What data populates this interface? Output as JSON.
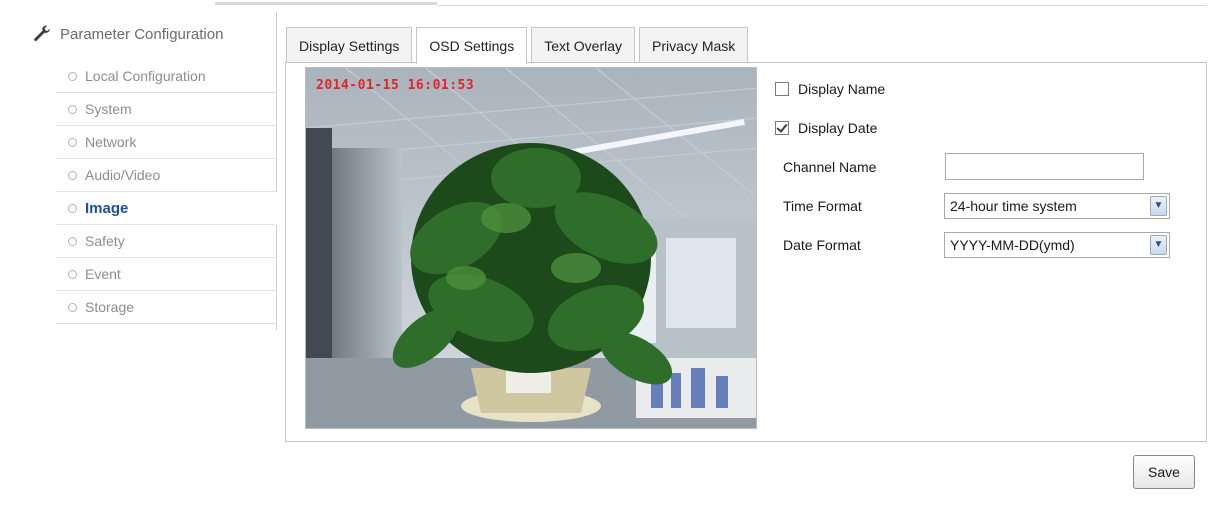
{
  "sidebar": {
    "title": "Parameter Configuration",
    "title_icon": "wrench-icon",
    "items": [
      {
        "label": "Local Configuration",
        "active": false
      },
      {
        "label": "System",
        "active": false
      },
      {
        "label": "Network",
        "active": false
      },
      {
        "label": "Audio/Video",
        "active": false
      },
      {
        "label": "Image",
        "active": true
      },
      {
        "label": "Safety",
        "active": false
      },
      {
        "label": "Event",
        "active": false
      },
      {
        "label": "Storage",
        "active": false
      }
    ]
  },
  "tabs": [
    {
      "label": "Display Settings",
      "active": false
    },
    {
      "label": "OSD Settings",
      "active": true
    },
    {
      "label": "Text Overlay",
      "active": false
    },
    {
      "label": "Privacy Mask",
      "active": false
    }
  ],
  "preview": {
    "osd_text": "2014-01-15 16:01:53",
    "osd_color": "#e4232a"
  },
  "osd": {
    "display_name": {
      "label": "Display Name",
      "checked": false
    },
    "display_date": {
      "label": "Display Date",
      "checked": true
    },
    "channel_name": {
      "label": "Channel Name",
      "value": ""
    },
    "time_format": {
      "label": "Time Format",
      "value": "24-hour time system"
    },
    "date_format": {
      "label": "Date Format",
      "value": "YYYY-MM-DD(ymd)"
    }
  },
  "actions": {
    "save_label": "Save"
  },
  "colors": {
    "accent": "#1f4f9a",
    "border": "#c6c6c6"
  }
}
